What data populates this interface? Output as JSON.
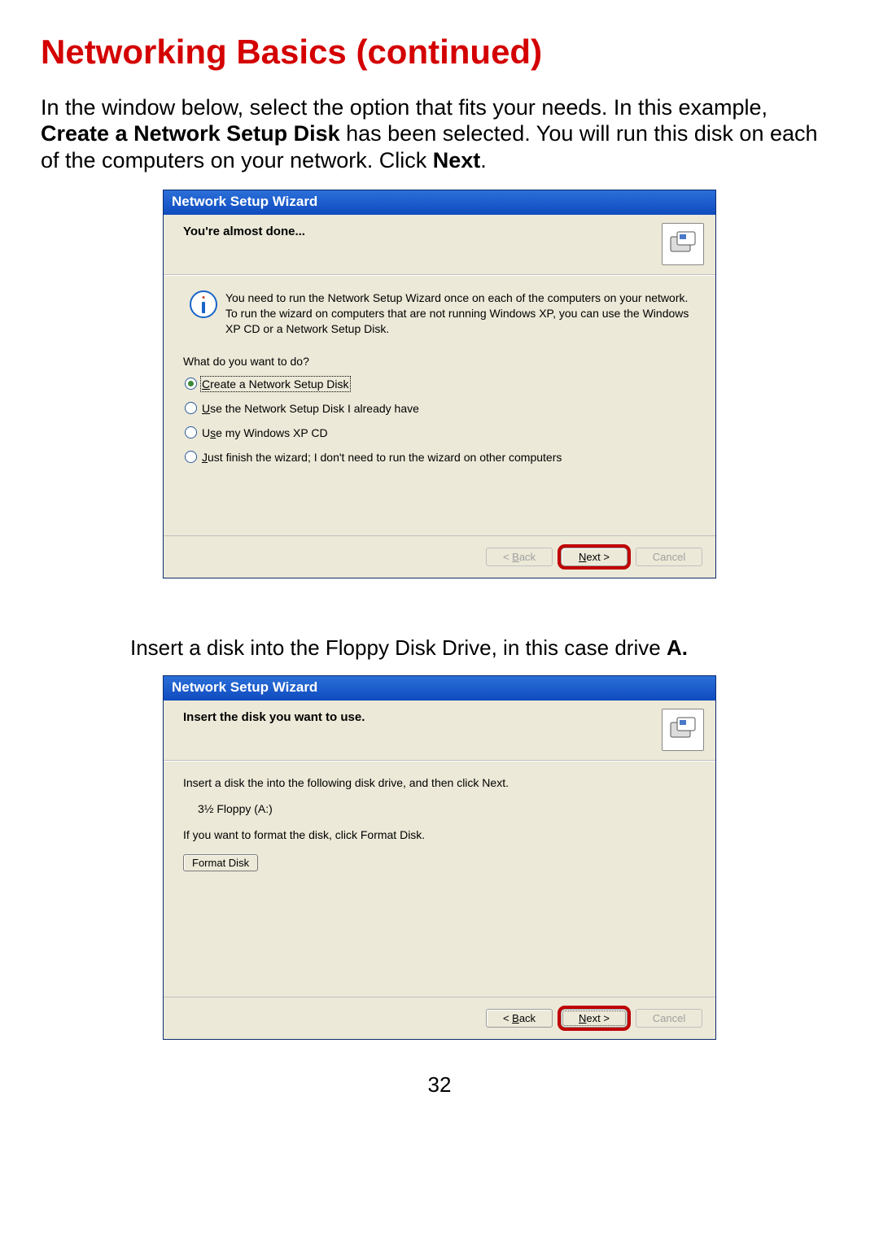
{
  "page": {
    "title": "Networking Basics (continued)",
    "intro_pre": "In the window below, select the option that fits your needs. In this example, ",
    "intro_bold1": "Create a Network Setup Disk",
    "intro_mid": " has been selected. You will run this disk on each of the computers on your network. Click ",
    "intro_bold2": "Next",
    "intro_post": ".",
    "caption2_pre": "Insert a disk into the Floppy Disk Drive, in this case drive ",
    "caption2_bold": "A.",
    "page_number": "32"
  },
  "wizard1": {
    "title": "Network Setup Wizard",
    "header": "You're almost done...",
    "info": "You need to run the Network Setup Wizard once on each of the computers on your network. To run the wizard on computers that are not running Windows XP, you can use the Windows XP CD or a Network Setup Disk.",
    "question": "What do you want to do?",
    "options": {
      "o1_c": "C",
      "o1_rest": "reate a Network Setup Disk",
      "o2_u": "U",
      "o2_rest": "se the Network Setup Disk I already have",
      "o3_pre": "U",
      "o3_s": "s",
      "o3_rest": "e my Windows XP CD",
      "o4_j": "J",
      "o4_rest": "ust finish the wizard; I don't need to run the wizard on other computers"
    },
    "buttons": {
      "back_pre": "< ",
      "back_b": "B",
      "back_rest": "ack",
      "next_n": "N",
      "next_rest": "ext >",
      "cancel": "Cancel"
    }
  },
  "wizard2": {
    "title": "Network Setup Wizard",
    "header": "Insert the disk you want to use.",
    "line1": "Insert a disk the into the following disk drive, and then click Next.",
    "drive": "3½ Floppy (A:)",
    "line2": "If you want to format the disk, click Format Disk.",
    "format_f": "F",
    "format_rest": "ormat Disk",
    "buttons": {
      "back_pre": "< ",
      "back_b": "B",
      "back_rest": "ack",
      "next_n": "N",
      "next_rest": "ext >",
      "cancel": "Cancel"
    }
  }
}
